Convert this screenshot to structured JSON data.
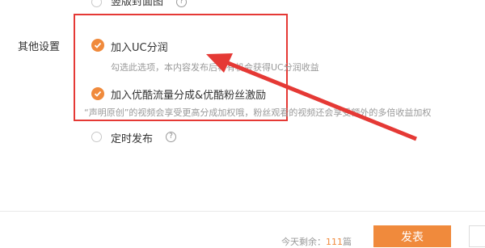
{
  "options": {
    "vertical_cover": {
      "label": "竖版封面图",
      "help_icon": "question-icon"
    },
    "join_uc": {
      "label": "加入UC分润",
      "hint": "勾选此选项，本内容发布后将有机会获得UC分润收益"
    },
    "youku": {
      "label": "加入优酷流量分成&优酷粉丝激励",
      "hint": "“声明原创”的视频会享受更高分成加权哦，粉丝观看的视频还会享受额外的多倍收益加权"
    },
    "scheduled": {
      "label": "定时发布",
      "help_icon": "question-icon"
    }
  },
  "section": {
    "other_settings": "其他设置"
  },
  "footer": {
    "remaining_label": "今天剩余：",
    "remaining_count": "111",
    "remaining_unit": "篇",
    "publish_label": "发表"
  },
  "colors": {
    "accent": "#f08a3c",
    "highlight": "#e53935"
  }
}
